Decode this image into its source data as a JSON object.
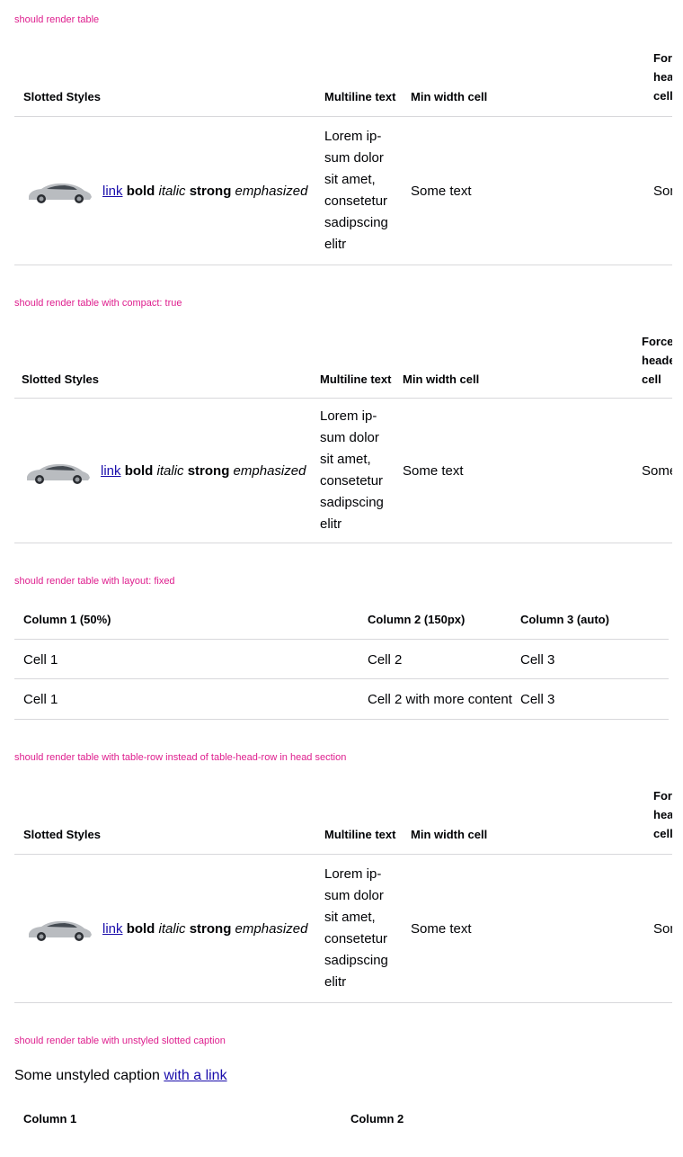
{
  "sections": [
    {
      "label": "should render table"
    },
    {
      "label": "should render table with compact: true"
    },
    {
      "label": "should render table with layout: fixed"
    },
    {
      "label": "should render table with table-row instead of table-head-row in head section"
    },
    {
      "label": "should render table with unstyled slotted caption"
    }
  ],
  "styled_table": {
    "headers": {
      "slotted": "Slotted Styles",
      "multiline": "Multiline text",
      "minwidth": "Min width cell",
      "forced_line1": "Forced",
      "forced_line2": "header",
      "forced_line3": "cell"
    },
    "row": {
      "car_icon": "car-image",
      "link": "link",
      "bold": "bold",
      "italic": "italic",
      "strong": "strong",
      "emphasized": "emphasized",
      "multiline_lines": [
        "Lorem ip-",
        "sum dolor",
        "sit amet,",
        "consetetur",
        "sadipscing",
        "elitr"
      ],
      "minwidth": "Some text",
      "forced": "Some text"
    }
  },
  "fixed_table": {
    "headers": [
      "Column 1 (50%)",
      "Column 2 (150px)",
      "Column 3 (auto)"
    ],
    "rows": [
      [
        "Cell 1",
        "Cell 2",
        "Cell 3"
      ],
      [
        "Cell 1",
        "Cell 2 with more content",
        "Cell 3"
      ]
    ]
  },
  "caption_table": {
    "caption_text": "Some unstyled caption ",
    "caption_link": "with a link",
    "headers": [
      "Column 1",
      "Column 2"
    ]
  }
}
